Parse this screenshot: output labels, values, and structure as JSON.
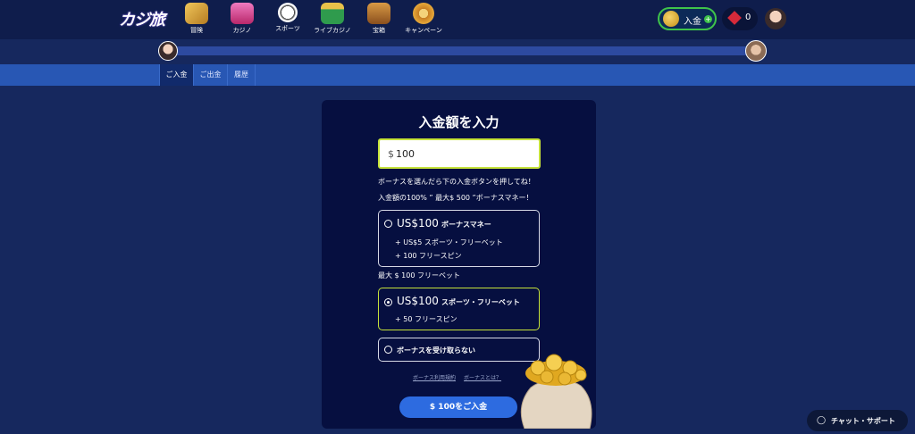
{
  "header": {
    "logo": "カジ旅",
    "nav": [
      {
        "label": "冒険",
        "icon": "map-icon",
        "color": "#e6b43a"
      },
      {
        "label": "カジノ",
        "icon": "slot-machine-icon",
        "color": "#e050a0"
      },
      {
        "label": "スポーツ",
        "icon": "soccer-ball-icon",
        "color": "#ffffff"
      },
      {
        "label": "ライブカジノ",
        "icon": "roulette-table-icon",
        "color": "#3aa655"
      },
      {
        "label": "宝箱",
        "icon": "treasure-chest-icon",
        "color": "#c47a2a"
      },
      {
        "label": "キャンペーン",
        "icon": "campaign-wheel-icon",
        "color": "#d69a30"
      }
    ],
    "deposit_label": "入金",
    "gem_count": "0"
  },
  "tabs": [
    "ご入金",
    "ご出金",
    "履歴"
  ],
  "panel": {
    "title": "入金額を入力",
    "currency_symbol": "$",
    "amount": "100",
    "hint": "ボーナスを選んだら下の入金ボタンを押してね！",
    "bonus_summary": "入金額の100% ” 最大$ 500 ”ボーナスマネー！",
    "options": [
      {
        "amount": "US$100",
        "kind": "ボーナスマネー",
        "lines": [
          "+  US$5  スポーツ・フリーベット",
          "+  100  フリースピン"
        ],
        "selected": false
      },
      {
        "amount": "US$100",
        "kind": "スポーツ・フリーベット",
        "lines": [
          "+  50  フリースピン"
        ],
        "selected": true
      },
      {
        "amount": "",
        "kind": "ボーナスを受け取らない",
        "lines": [],
        "selected": false
      }
    ],
    "freebet_max": "最大 $ 100 フリーベット",
    "terms_link": "ボーナス利用規約",
    "whatis_link": "ボーナスとは？",
    "submit_label": "$ 100をご入金"
  },
  "chat_label": "チャット・サポート",
  "colors": {
    "accent": "#2d6be0",
    "selected_border": "#c6e23a",
    "deposit_border": "#3fc34a"
  }
}
